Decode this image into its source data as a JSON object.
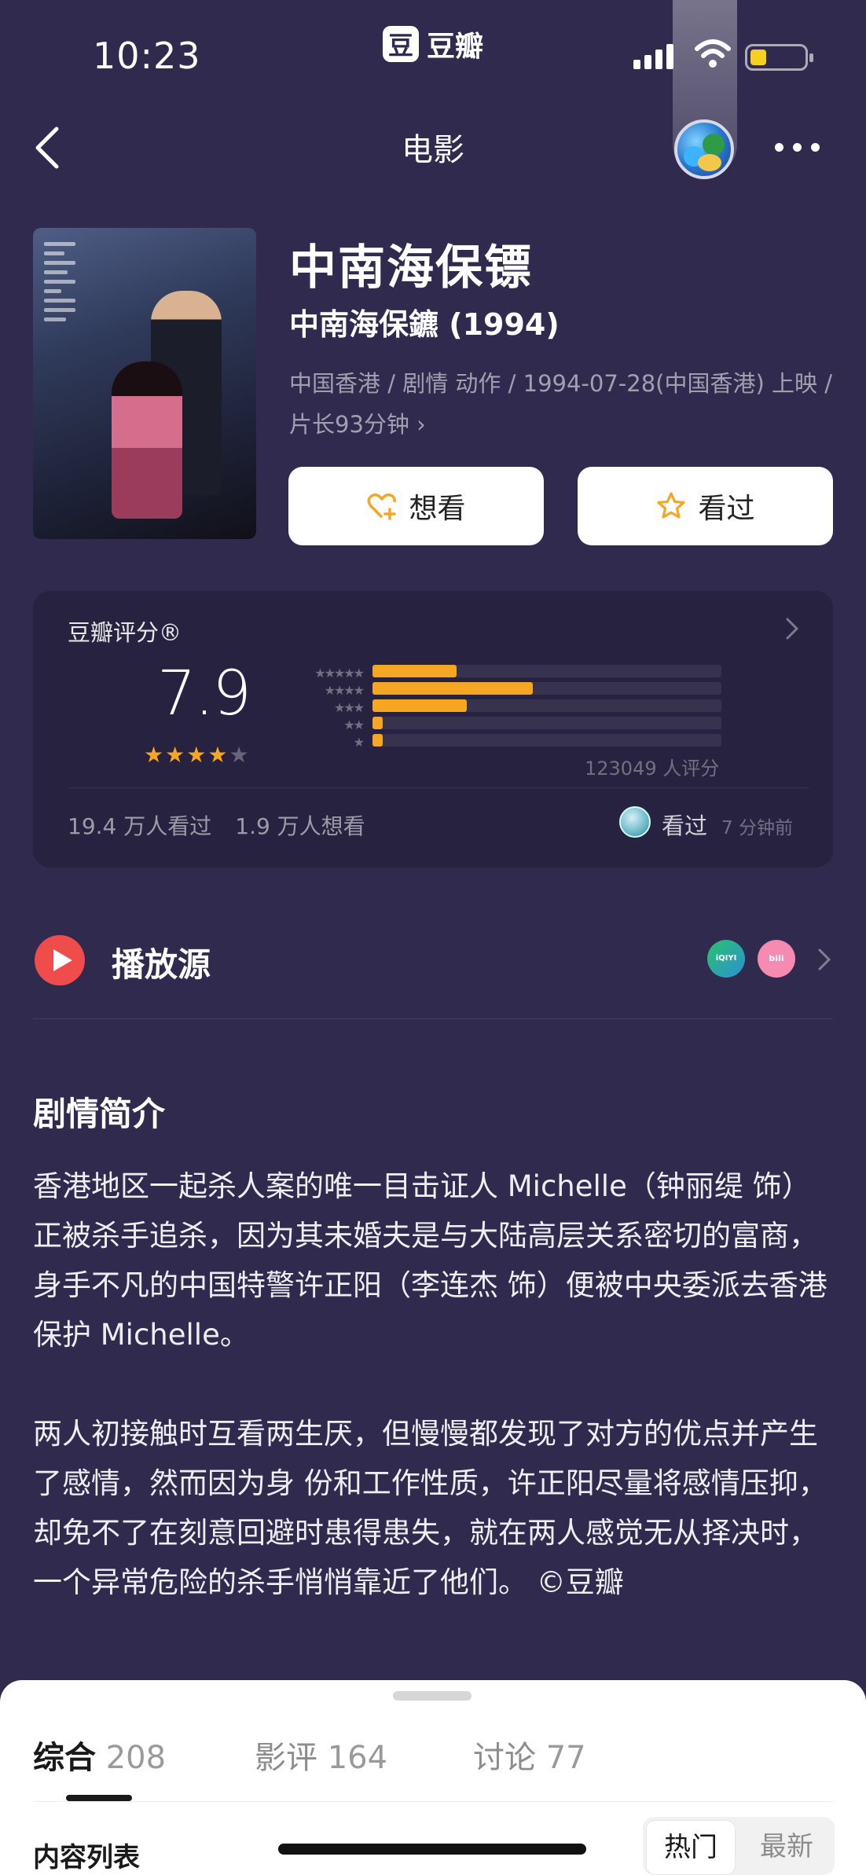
{
  "status_bar": {
    "time": "10:23",
    "app_logo": "豆",
    "app_name": "豆瓣"
  },
  "nav": {
    "title": "电影",
    "back_icon": "chevron-left-icon",
    "more_icon": "more-dots-icon"
  },
  "movie": {
    "title_cn": "中南海保镖",
    "title_original": "中南海保鑣 (1994)",
    "meta": "中国香港 / 剧情 动作 / 1994-07-28(中国香港) 上映 / 片长93分钟 ›"
  },
  "actions": {
    "want_label": "想看",
    "seen_label": "看过"
  },
  "rating": {
    "title": "豆瓣评分®",
    "score": "7.9",
    "stars": 4,
    "star_labels": [
      "★★★★★",
      "★★★★",
      "★★★",
      "★★",
      "★"
    ],
    "distribution": [
      0.24,
      0.46,
      0.27,
      0.03,
      0.03
    ],
    "votes": "123049 人评分",
    "watched": "19.4 万人看过",
    "wanted": "1.9 万人想看",
    "friend_action": "看过",
    "friend_time": "7 分钟前",
    "colors": {
      "bar": "#f5a623",
      "star": "#f5a623"
    }
  },
  "play": {
    "label": "播放源",
    "sources": [
      {
        "name": "iQIYI 爱奇艺"
      },
      {
        "name": "bilibili"
      }
    ]
  },
  "synopsis": {
    "title": "剧情简介",
    "p1": "香港地区一起杀人案的唯一目击证人 Michelle（钟丽缇 饰）正被杀手追杀，因为其未婚夫是与大陆高层关系密切的富商，身手不凡的中国特警许正阳（李连杰 饰）便被中央委派去香港保护 Michelle。",
    "p2": "两人初接触时互看两生厌，但慢慢都发现了对方的优点并产生了感情，然而因为身 份和工作性质，许正阳尽量将感情压抑，却免不了在刻意回避时患得患失，就在两人感觉无从择决时，一个异常危险的杀手悄悄靠近了他们。 ©豆瓣"
  },
  "sheet": {
    "tabs": [
      {
        "label": "综合",
        "count": "208"
      },
      {
        "label": "影评",
        "count": "164"
      },
      {
        "label": "讨论",
        "count": "77"
      }
    ],
    "list_title": "内容列表",
    "sort_hot": "热门",
    "sort_new": "最新"
  }
}
